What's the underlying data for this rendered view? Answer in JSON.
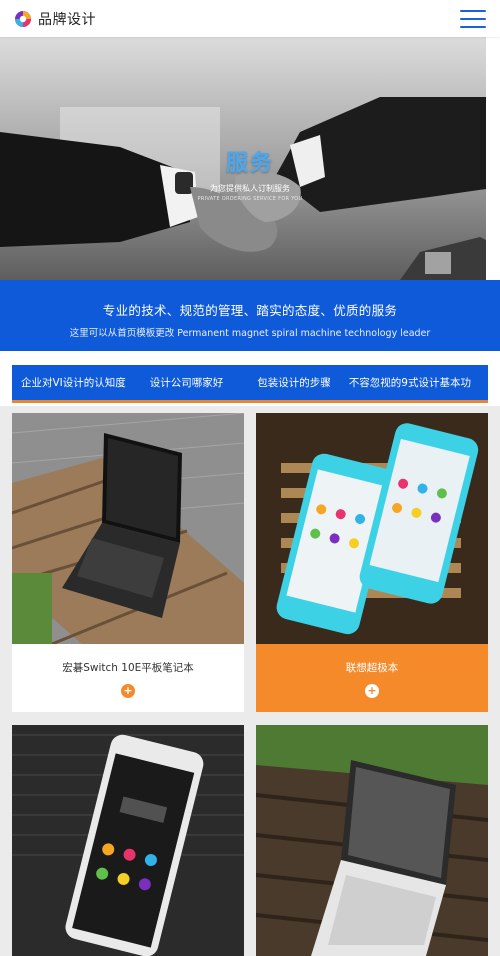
{
  "header": {
    "brand_name": "品牌设计",
    "logo_icon": "brand-logo-icon",
    "menu_icon": "hamburger-menu-icon",
    "accent": "#1a63d8"
  },
  "hero": {
    "title": "服务",
    "subtitle": "为您提供私人订制服务",
    "subtitle_en": "PRIVATE ORDERING SERVICE FOR YOU"
  },
  "band": {
    "title": "专业的技术、规范的管理、踏实的态度、优质的服务",
    "subtitle": "这里可以从首页模板更改 Permanent magnet spiral machine technology leader",
    "color": "#0f5ad8"
  },
  "tabs": [
    {
      "label": "企业对VI设计的认知度"
    },
    {
      "label": "设计公司哪家好"
    },
    {
      "label": "包装设计的步骤"
    },
    {
      "label": "不容忽视的9式设计基本功"
    }
  ],
  "products": [
    {
      "title": "宏碁Switch 10E平板笔记本",
      "more": "+",
      "style": "white"
    },
    {
      "title": "联想超极本",
      "more": "+",
      "style": "orange"
    },
    {
      "title": "",
      "more": "+",
      "style": "white"
    },
    {
      "title": "",
      "more": "+",
      "style": "white"
    }
  ],
  "colors": {
    "orange": "#f58a2b",
    "blue": "#0f5ad8",
    "page_bg": "#ebebeb"
  }
}
